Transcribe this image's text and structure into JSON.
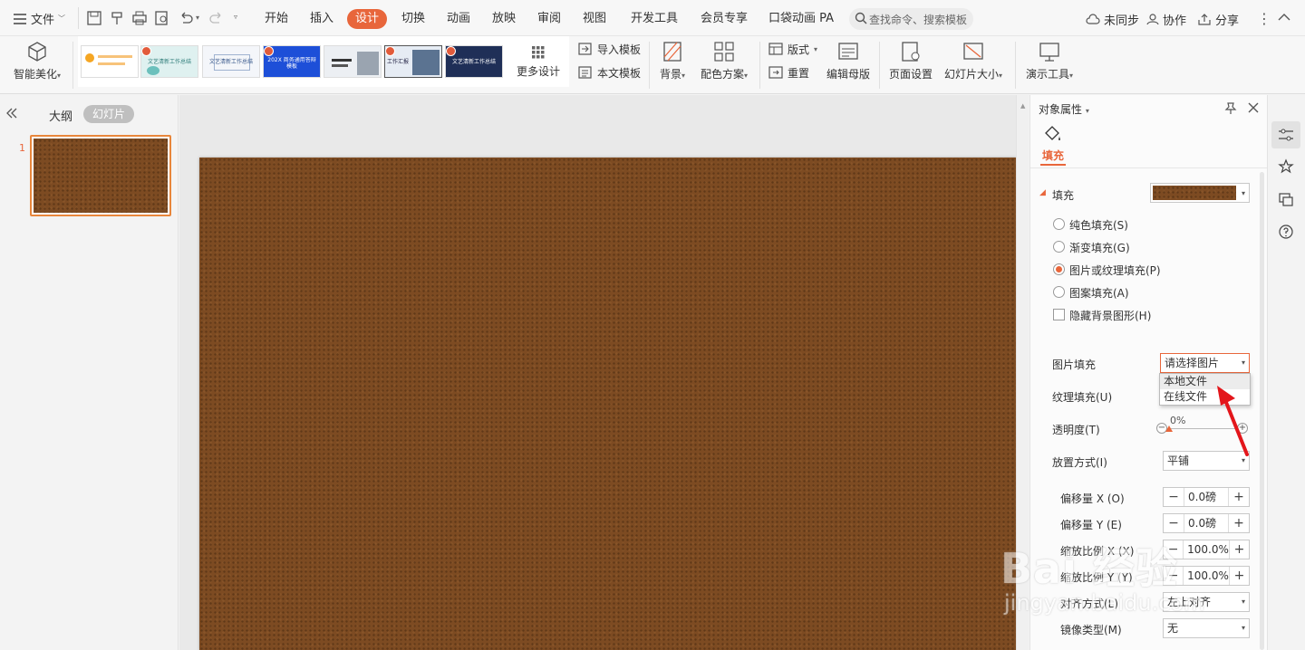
{
  "menubar": {
    "file_label": "文件",
    "tabs": [
      "开始",
      "插入",
      "设计",
      "切换",
      "动画",
      "放映",
      "审阅",
      "视图",
      "开发工具",
      "会员专享",
      "口袋动画 PA"
    ],
    "active_tab": "设计",
    "search_placeholder": "查找命令、搜索模板",
    "sync_label": "未同步",
    "collab_label": "协作",
    "share_label": "分享"
  },
  "ribbon": {
    "beautify_label": "智能美化",
    "templates": [
      {
        "title": "",
        "icon": "template-orange-icon"
      },
      {
        "title": "文艺清新工作总结",
        "icon": "template-teal-icon"
      },
      {
        "title": "文艺清新工作总结",
        "icon": "template-white-icon"
      },
      {
        "title": "202X 商务通用答辩模板",
        "icon": "template-blue-icon"
      },
      {
        "title": "",
        "icon": "template-gray-icon"
      },
      {
        "title": "工作汇报",
        "icon": "template-photo-icon"
      },
      {
        "title": "文艺清新工作总结",
        "icon": "template-navy-icon"
      }
    ],
    "more_design_label": "更多设计",
    "import_template_label": "导入模板",
    "this_template_label": "本文模板",
    "background_label": "背景",
    "color_scheme_label": "配色方案",
    "layout_label": "版式",
    "reset_label": "重置",
    "edit_master_label": "编辑母版",
    "page_setup_label": "页面设置",
    "slide_size_label": "幻灯片大小",
    "presentation_tools_label": "演示工具"
  },
  "left_panel": {
    "outline_tab": "大纲",
    "slides_tab": "幻灯片",
    "slide_number": "1"
  },
  "right_panel": {
    "title": "对象属性",
    "fill_tab": "填充",
    "fill_section": "填充",
    "options": {
      "solid": "纯色填充(S)",
      "gradient": "渐变填充(G)",
      "picture": "图片或纹理填充(P)",
      "pattern": "图案填充(A)",
      "hide_bg": "隐藏背景图形(H)"
    },
    "picture_fill_label": "图片填充",
    "picture_fill_value": "请选择图片",
    "dropdown_options": [
      "本地文件",
      "在线文件"
    ],
    "texture_fill_label": "纹理填充(U)",
    "transparency_label": "透明度(T)",
    "transparency_value": "0%",
    "transparency_level": 0,
    "placement_label": "放置方式(I)",
    "placement_value": "平铺",
    "offset_x_label": "偏移量 X (O)",
    "offset_x_value": "0.0磅",
    "offset_y_label": "偏移量 Y (E)",
    "offset_y_value": "0.0磅",
    "scale_x_label": "缩放比例 X (X)",
    "scale_x_value": "100.0%",
    "scale_y_label": "缩放比例 Y (Y)",
    "scale_y_value": "100.0%",
    "align_label": "对齐方式(L)",
    "align_value": "左上对齐",
    "mirror_label": "镜像类型(M)",
    "mirror_value": "无"
  },
  "watermark": {
    "line1": "Bai 经验",
    "line2": "jingyan.baidu.com"
  },
  "colors": {
    "accent": "#e8663b",
    "leather": "#7d4b22",
    "arrow": "#e3161b"
  }
}
